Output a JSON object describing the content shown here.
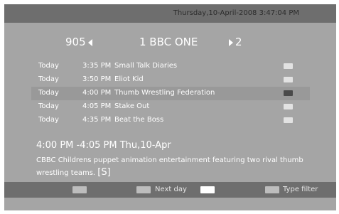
{
  "header": {
    "datetime": "Thursday,10-April-2008 3:47:04 PM"
  },
  "channel_bar": {
    "prev_number": "905",
    "current": "1  BBC ONE",
    "next_number": "2"
  },
  "schedule": [
    {
      "day": "Today",
      "time": "3:35 PM",
      "title": "Small Talk Diaries",
      "selected": false
    },
    {
      "day": "Today",
      "time": "3:50 PM",
      "title": "Eliot Kid",
      "selected": false
    },
    {
      "day": "Today",
      "time": "4:00 PM",
      "title": "Thumb Wrestling Federation",
      "selected": true
    },
    {
      "day": "Today",
      "time": "4:05 PM",
      "title": "Stake Out",
      "selected": false
    },
    {
      "day": "Today",
      "time": "4:35 PM",
      "title": "Beat the Boss",
      "selected": false
    }
  ],
  "detail": {
    "time_range": "4:00 PM  -4:05 PM Thu,10-Apr",
    "description": "CBBC Childrens puppet animation entertainment featuring two rival thumb wrestling teams. ",
    "tag": "[S]"
  },
  "footer": {
    "green_label": "Next day",
    "blue_label": "Type filter"
  }
}
